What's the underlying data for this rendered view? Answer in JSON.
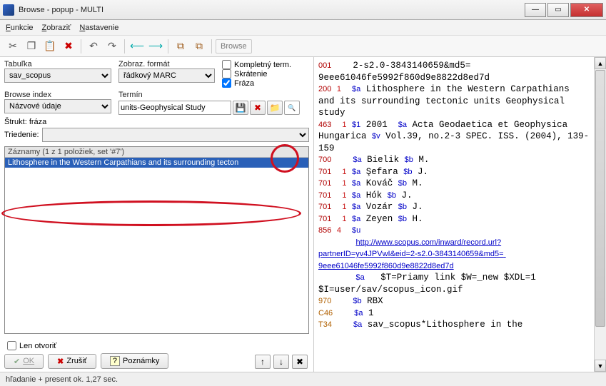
{
  "window": {
    "title": "Browse - popup - MULTI"
  },
  "menu": [
    "Funkcie",
    "Zobraziť",
    "Nastavenie"
  ],
  "toolbar": {
    "browse": "Browse"
  },
  "search": {
    "table_label": "Tabuľka",
    "table_value": "sav_scopus",
    "format_label": "Zobraz. formát",
    "format_value": "řádkový MARC",
    "index_label": "Browse index",
    "index_value": "Názvové údaje",
    "termin_label": "Termín",
    "termin_value": "units-Geophysical Study",
    "check_komplet": "Kompletný term.",
    "check_skrat": "Skrátenie",
    "check_fraza": "Fráza",
    "struct_label": "Štrukt: fráza",
    "sort_label": "Triedenie:"
  },
  "list": {
    "header": "Záznamy (1 z 1 položiek, set '#7')",
    "item": "Lithosphere in the Western Carpathians and its surrounding tecton"
  },
  "buttons": {
    "len_otvorit": "Len otvoriť",
    "ok": "OK",
    "cancel": "Zrušiť",
    "notes": "Poznámky"
  },
  "marc": {
    "l001_tag": "001",
    "l001": "2-s2.0-3843140659&md5= 9eee61046fe5992f860d9e8822d8ed7d",
    "l200_tag": "200",
    "l200_ind": "1",
    "l200_a": "$a",
    "l200": " Lithosphere in the Western Carpathians and its surrounding tectonic units Geophysical study",
    "l463_tag": "463",
    "l463_ind": "1",
    "l463_1": "$1",
    "l463_year": " 2001  ",
    "l463_a": "$a",
    "l463_txt": " Acta Geodaetica et Geophysica Hungarica ",
    "l463_v": "$v",
    "l463_vtxt": " Vol.39, no.2-3 SPEC. ISS. (2004), 139-159",
    "l700_tag": "700",
    "l700_a": "$a",
    "l700_surname": " Bielik ",
    "l700_b": "$b",
    "l700_init": " M.",
    "l701": [
      {
        "tag": "701",
        "ind": "1",
        "a": "$a",
        "surname": " Şefara ",
        "b": "$b",
        "init": " J."
      },
      {
        "tag": "701",
        "ind": "1",
        "a": "$a",
        "surname": " Kováč ",
        "b": "$b",
        "init": " M."
      },
      {
        "tag": "701",
        "ind": "1",
        "a": "$a",
        "surname": " Hók ",
        "b": "$b",
        "init": " J."
      },
      {
        "tag": "701",
        "ind": "1",
        "a": "$a",
        "surname": " Vozár ",
        "b": "$b",
        "init": " J."
      },
      {
        "tag": "701",
        "ind": "1",
        "a": "$a",
        "surname": " Zeyen ",
        "b": "$b",
        "init": " H."
      }
    ],
    "l856_tag": "856",
    "l856_ind": "4",
    "l856_u": "$u",
    "l856_url": "http://www.scopus.com/inward/record.url?partnerID=yv4JPVwI&eid=2-s2.0-3843140659&md5= 9eee61046fe5992f860d9e8822d8ed7d",
    "l856_extra_a": "$a",
    "l856_extra": "   $T=Priamy link $W=_new $XDL=1 $I=user/sav/scopus_icon.gif",
    "l970_tag": "970",
    "l970_b": "$b",
    "l970_txt": " RBX",
    "lC46_tag": "C46",
    "lC46_a": "$a",
    "lC46_txt": " 1",
    "lT34_tag": "T34",
    "lT34_a": "$a",
    "lT34_txt": " sav_scopus*Lithosphere in the"
  },
  "status": "hľadanie + present ok. 1,27 sec."
}
